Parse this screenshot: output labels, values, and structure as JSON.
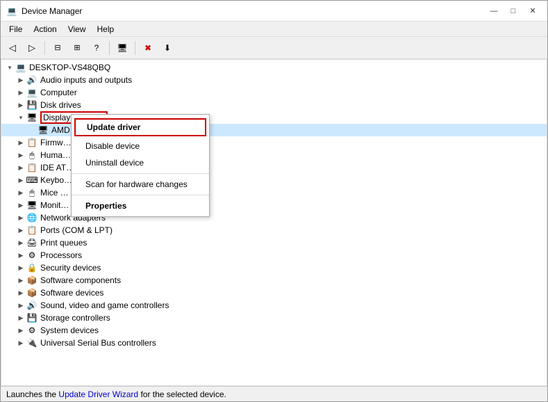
{
  "window": {
    "title": "Device Manager",
    "icon": "💻"
  },
  "menus": [
    "File",
    "Action",
    "View",
    "Help"
  ],
  "toolbar_buttons": [
    "◁",
    "▷",
    "□",
    "□",
    "?",
    "□",
    "🖥",
    "✖",
    "⬇"
  ],
  "tree": {
    "root_label": "DESKTOP-VS48QBQ",
    "items": [
      {
        "id": "audio",
        "label": "Audio inputs and outputs",
        "indent": 1,
        "expanded": false,
        "icon": "🔊"
      },
      {
        "id": "computer",
        "label": "Computer",
        "indent": 1,
        "expanded": false,
        "icon": "💻"
      },
      {
        "id": "disk",
        "label": "Disk drives",
        "indent": 1,
        "expanded": false,
        "icon": "💾"
      },
      {
        "id": "display",
        "label": "Display adapters",
        "indent": 1,
        "expanded": true,
        "icon": "🖥",
        "highlight_border": true
      },
      {
        "id": "display-child",
        "label": "AMD Radeon RX Vega 11 Graphics",
        "indent": 2,
        "expanded": false,
        "icon": "🖥",
        "selected": true
      },
      {
        "id": "firmware",
        "label": "Firmware",
        "indent": 1,
        "expanded": false,
        "icon": "📋"
      },
      {
        "id": "huma",
        "label": "Human Interface Devices",
        "indent": 1,
        "expanded": false,
        "icon": "🖱"
      },
      {
        "id": "ide",
        "label": "IDE ATA/ATAPI controllers",
        "indent": 1,
        "expanded": false,
        "icon": "📋"
      },
      {
        "id": "keyboards",
        "label": "Keyboards",
        "indent": 1,
        "expanded": false,
        "icon": "⌨"
      },
      {
        "id": "mice",
        "label": "Mice and other pointing devices",
        "indent": 1,
        "expanded": false,
        "icon": "🖱"
      },
      {
        "id": "monitors",
        "label": "Monitors",
        "indent": 1,
        "expanded": false,
        "icon": "🖥"
      },
      {
        "id": "network",
        "label": "Network adapters",
        "indent": 1,
        "expanded": false,
        "icon": "🌐"
      },
      {
        "id": "ports",
        "label": "Ports (COM & LPT)",
        "indent": 1,
        "expanded": false,
        "icon": "📋"
      },
      {
        "id": "print",
        "label": "Print queues",
        "indent": 1,
        "expanded": false,
        "icon": "🖨"
      },
      {
        "id": "proc",
        "label": "Processors",
        "indent": 1,
        "expanded": false,
        "icon": "⚙"
      },
      {
        "id": "security",
        "label": "Security devices",
        "indent": 1,
        "expanded": false,
        "icon": "🔒"
      },
      {
        "id": "software-comp",
        "label": "Software components",
        "indent": 1,
        "expanded": false,
        "icon": "📦"
      },
      {
        "id": "software-dev",
        "label": "Software devices",
        "indent": 1,
        "expanded": false,
        "icon": "📦"
      },
      {
        "id": "sound",
        "label": "Sound, video and game controllers",
        "indent": 1,
        "expanded": false,
        "icon": "🔊"
      },
      {
        "id": "storage",
        "label": "Storage controllers",
        "indent": 1,
        "expanded": false,
        "icon": "💾"
      },
      {
        "id": "system",
        "label": "System devices",
        "indent": 1,
        "expanded": false,
        "icon": "⚙"
      },
      {
        "id": "usb",
        "label": "Universal Serial Bus controllers",
        "indent": 1,
        "expanded": false,
        "icon": "🔌"
      }
    ]
  },
  "context_menu": {
    "visible": true,
    "items": [
      {
        "id": "update-driver",
        "label": "Update driver",
        "type": "highlighted"
      },
      {
        "id": "disable-device",
        "label": "Disable device",
        "type": "normal"
      },
      {
        "id": "uninstall-device",
        "label": "Uninstall device",
        "type": "normal"
      },
      {
        "id": "sep1",
        "type": "separator"
      },
      {
        "id": "scan-hardware",
        "label": "Scan for hardware changes",
        "type": "normal"
      },
      {
        "id": "sep2",
        "type": "separator"
      },
      {
        "id": "properties",
        "label": "Properties",
        "type": "bold"
      }
    ]
  },
  "status_bar": {
    "text": "Launches the Update Driver Wizard for the selected device.",
    "highlight_word": "Update Driver Wizard"
  }
}
